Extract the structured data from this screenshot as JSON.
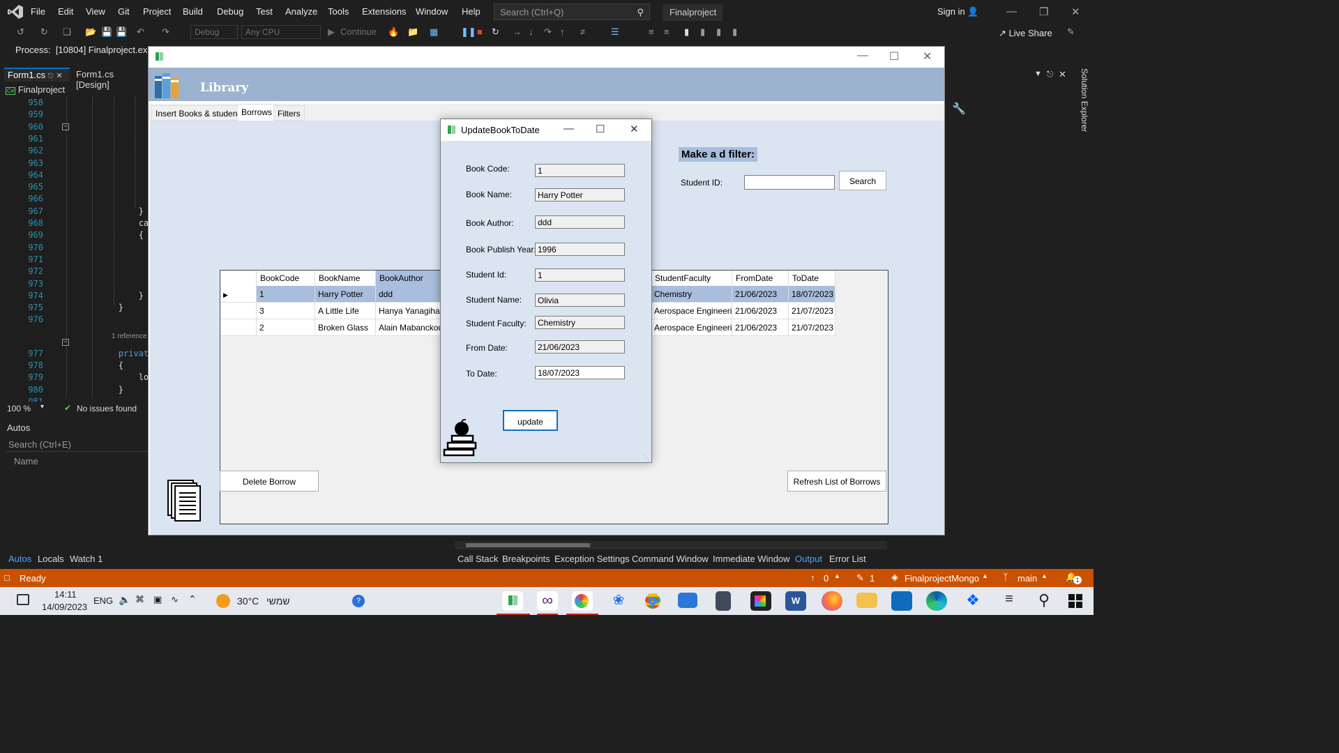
{
  "vs": {
    "menu": [
      "File",
      "Edit",
      "View",
      "Git",
      "Project",
      "Build",
      "Debug",
      "Test",
      "Analyze",
      "Tools",
      "Extensions",
      "Window",
      "Help"
    ],
    "search_placeholder": "Search (Ctrl+Q)",
    "project_name": "Finalproject",
    "sign_in": "Sign in",
    "toolbar": {
      "config": "Debug",
      "platform": "Any CPU",
      "continue": "Continue"
    },
    "live_share": "Live Share",
    "process": "Process:",
    "process_value": "[10804] Finalproject.exe",
    "tabs": [
      "Form1.cs",
      "Form1.cs [Design]"
    ],
    "nav_project": "Finalproject",
    "zoom": "100 %",
    "no_issues": "No issues found",
    "autos_title": "Autos",
    "autos_search": "Search (Ctrl+E)",
    "autos_col": "Name",
    "bottom_tabs_left": [
      "Autos",
      "Locals",
      "Watch 1"
    ],
    "bottom_tabs_right": [
      "Call Stack",
      "Breakpoints",
      "Exception Settings",
      "Command Window",
      "Immediate Window",
      "Output",
      "Error List"
    ],
    "status": {
      "ready": "Ready",
      "up": "0",
      "pencil": "1",
      "repo": "FinalprojectMongo",
      "branch": "main",
      "notif": "1"
    },
    "solution_explorer": "Solution Explorer"
  },
  "code": {
    "lines": [
      {
        "n": "958",
        "t": ""
      },
      {
        "n": "959",
        "t": ""
      },
      {
        "n": "960",
        "t": ""
      },
      {
        "n": "961",
        "t": ""
      },
      {
        "n": "962",
        "t": ""
      },
      {
        "n": "963",
        "t": ""
      },
      {
        "n": "964",
        "t": ""
      },
      {
        "n": "965",
        "t": ""
      },
      {
        "n": "966",
        "t": ""
      },
      {
        "n": "967",
        "t": "            }"
      },
      {
        "n": "968",
        "t": "            cat"
      },
      {
        "n": "969",
        "t": "            {"
      },
      {
        "n": "970",
        "t": ""
      },
      {
        "n": "971",
        "t": ""
      },
      {
        "n": "972",
        "t": ""
      },
      {
        "n": "973",
        "t": ""
      },
      {
        "n": "974",
        "t": "            }"
      },
      {
        "n": "975",
        "t": "        }"
      },
      {
        "n": "976",
        "t": ""
      }
    ],
    "reference": "1 reference",
    "lines2": [
      {
        "n": "977",
        "t": "        private"
      },
      {
        "n": "978",
        "t": "        {"
      },
      {
        "n": "979",
        "t": "            loa"
      },
      {
        "n": "980",
        "t": "        }"
      },
      {
        "n": "981",
        "t": ""
      }
    ]
  },
  "library": {
    "title": "Library",
    "tabs": [
      "Insert Books & students",
      "Borrows",
      "Filters"
    ],
    "filter_title": "Make a d filter:",
    "student_id_label": "Student ID:",
    "search_button": "Search",
    "columns": [
      "BookCode",
      "BookName",
      "BookAuthor",
      "StudentFaculty",
      "FromDate",
      "ToDate"
    ],
    "rows": [
      {
        "code": "1",
        "name": "Harry Potter",
        "author": "ddd",
        "faculty": "Chemistry",
        "from": "21/06/2023",
        "to": "18/07/2023"
      },
      {
        "code": "3",
        "name": "A Little Life",
        "author": "Hanya Yanagihara",
        "faculty": "Aerospace Engineering",
        "from": "21/06/2023",
        "to": "21/07/2023"
      },
      {
        "code": "2",
        "name": "Broken Glass",
        "author": "Alain Mabanckou",
        "faculty": "Aerospace Engineering",
        "from": "21/06/2023",
        "to": "21/07/2023"
      }
    ],
    "delete_button": "Delete Borrow",
    "refresh_button": "Refresh List of Borrows"
  },
  "dialog": {
    "title": "UpdateBookToDate",
    "fields": [
      {
        "label": "Book Code:",
        "value": "1"
      },
      {
        "label": "Book Name:",
        "value": "Harry Potter"
      },
      {
        "label": "Book Author:",
        "value": "ddd"
      },
      {
        "label": "Book Publish Year:",
        "value": "1996"
      },
      {
        "label": "Student Id:",
        "value": "1"
      },
      {
        "label": "Student Name:",
        "value": "Olivia"
      },
      {
        "label": "Student Faculty:",
        "value": "Chemistry"
      },
      {
        "label": "From Date:",
        "value": "21/06/2023"
      },
      {
        "label": "To Date:",
        "value": "18/07/2023"
      }
    ],
    "update_button": "update"
  },
  "taskbar": {
    "time": "14:11",
    "date": "14/09/2023",
    "lang": "ENG",
    "weather": "30°C",
    "weather_text": "שמשי"
  }
}
